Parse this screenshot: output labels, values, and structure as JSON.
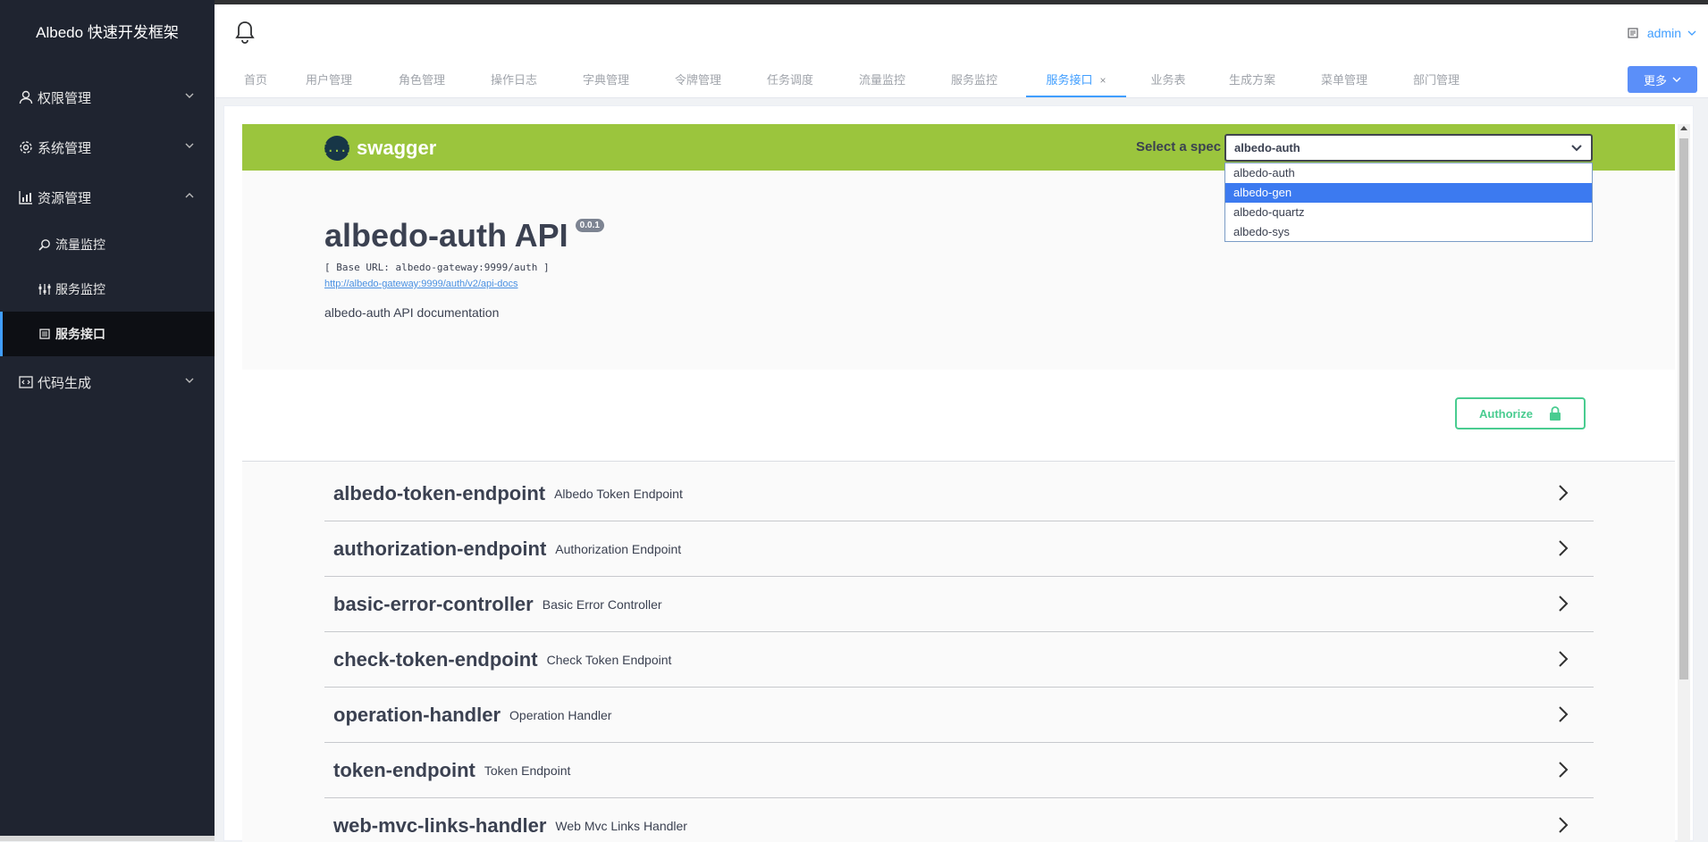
{
  "app": {
    "title": "Albedo 快速开发框架"
  },
  "sidebar": {
    "items": [
      {
        "label": "权限管理",
        "icon": "user-icon",
        "expanded": false
      },
      {
        "label": "系统管理",
        "icon": "gear-icon",
        "expanded": false
      },
      {
        "label": "资源管理",
        "icon": "chart-icon",
        "expanded": true
      },
      {
        "label": "代码生成",
        "icon": "code-icon",
        "expanded": false
      }
    ],
    "subitems": [
      {
        "label": "流量监控",
        "icon": "search-icon"
      },
      {
        "label": "服务监控",
        "icon": "sliders-icon"
      },
      {
        "label": "服务接口",
        "icon": "doc-icon",
        "active": true
      }
    ]
  },
  "header": {
    "user": "admin"
  },
  "tabs": [
    {
      "label": "首页"
    },
    {
      "label": "用户管理"
    },
    {
      "label": "角色管理"
    },
    {
      "label": "操作日志"
    },
    {
      "label": "字典管理"
    },
    {
      "label": "令牌管理"
    },
    {
      "label": "任务调度"
    },
    {
      "label": "流量监控"
    },
    {
      "label": "服务监控"
    },
    {
      "label": "服务接口",
      "active": true,
      "close": "×"
    },
    {
      "label": "业务表"
    },
    {
      "label": "生成方案"
    },
    {
      "label": "菜单管理"
    },
    {
      "label": "部门管理"
    }
  ],
  "more_label": "更多",
  "swagger": {
    "logo_text": "swagger",
    "logo_glyph": "{...}",
    "spec_label": "Select a spec",
    "selected_spec": "albedo-auth",
    "spec_options": [
      "albedo-auth",
      "albedo-gen",
      "albedo-quartz",
      "albedo-sys"
    ],
    "highlighted_option": "albedo-gen",
    "api_title": "albedo-auth API",
    "version": "0.0.1",
    "base_url": "[ Base URL: albedo-gateway:9999/auth ]",
    "docs_link": "http://albedo-gateway:9999/auth/v2/api-docs",
    "description": "albedo-auth API documentation",
    "authorize_label": "Authorize",
    "operations": [
      {
        "name": "albedo-token-endpoint",
        "desc": "Albedo Token Endpoint"
      },
      {
        "name": "authorization-endpoint",
        "desc": "Authorization Endpoint"
      },
      {
        "name": "basic-error-controller",
        "desc": "Basic Error Controller"
      },
      {
        "name": "check-token-endpoint",
        "desc": "Check Token Endpoint"
      },
      {
        "name": "operation-handler",
        "desc": "Operation Handler"
      },
      {
        "name": "token-endpoint",
        "desc": "Token Endpoint"
      },
      {
        "name": "web-mvc-links-handler",
        "desc": "Web Mvc Links Handler"
      }
    ]
  },
  "colors": {
    "accent": "#409eff",
    "swagger_green": "#9bc53d",
    "sidebar_bg": "#1f2430",
    "authorize": "#49cc90"
  }
}
